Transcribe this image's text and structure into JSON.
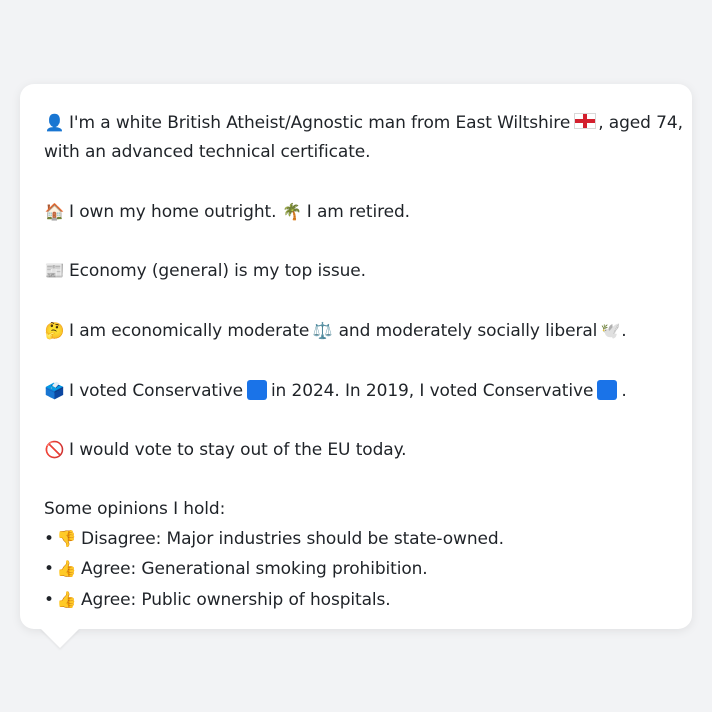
{
  "bubble": {
    "intro_line1": "I'm a white British Atheist/Agnostic man from East Wiltshire",
    "intro_line1_end": ", aged 74,",
    "intro_line2": "with an advanced technical certificate.",
    "home": "I own my home outright.",
    "retired": "I am retired.",
    "top_issue": "Economy (general) is my top issue.",
    "politics_a": "I am economically moderate",
    "politics_b": "and moderately socially liberal",
    "politics_end": ".",
    "vote_a": "I voted Conservative",
    "vote_b": "in 2024. In 2019, I voted Conservative",
    "vote_end": ".",
    "eu": "I would vote to stay out of the EU today.",
    "opinions_title": "Some opinions I hold:",
    "opinions": [
      {
        "bullet": "•",
        "emoji": "👎",
        "text": "Disagree: Major industries should be state-owned."
      },
      {
        "bullet": "•",
        "emoji": "👍",
        "text": "Agree: Generational smoking prohibition."
      },
      {
        "bullet": "•",
        "emoji": "👍",
        "text": "Agree: Public ownership of hospitals."
      }
    ]
  },
  "icons": {
    "person": "👤",
    "house": "🏠",
    "palm": "🌴",
    "newspaper": "📰",
    "thinking": "🤔",
    "scales": "⚖️",
    "dove": "🕊️",
    "ballot": "🗳️",
    "no_entry": "🚫"
  },
  "colors": {
    "page_bg": "#f2f3f5",
    "bubble_bg": "#ffffff",
    "conservative_blue": "#1a73e8",
    "england_red": "#d3202e"
  }
}
